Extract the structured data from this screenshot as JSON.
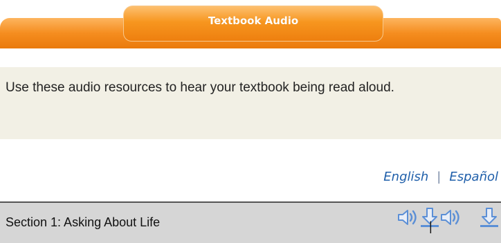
{
  "header": {
    "title": "Textbook Audio"
  },
  "description": {
    "text": "Use these audio resources to hear your textbook being read aloud."
  },
  "languages": {
    "english": "English",
    "separator": "|",
    "spanish": "Español"
  },
  "sections": [
    {
      "label": "Section 1: Asking About Life",
      "divider": "|"
    }
  ],
  "colors": {
    "accent": "#f58d1f",
    "panel": "#f2f0e5",
    "link": "#1f5faa",
    "row": "#d6d6d6",
    "icon": "#5b8fd6"
  },
  "icons": [
    "speaker-icon",
    "download-icon",
    "speaker-icon",
    "download-icon"
  ]
}
